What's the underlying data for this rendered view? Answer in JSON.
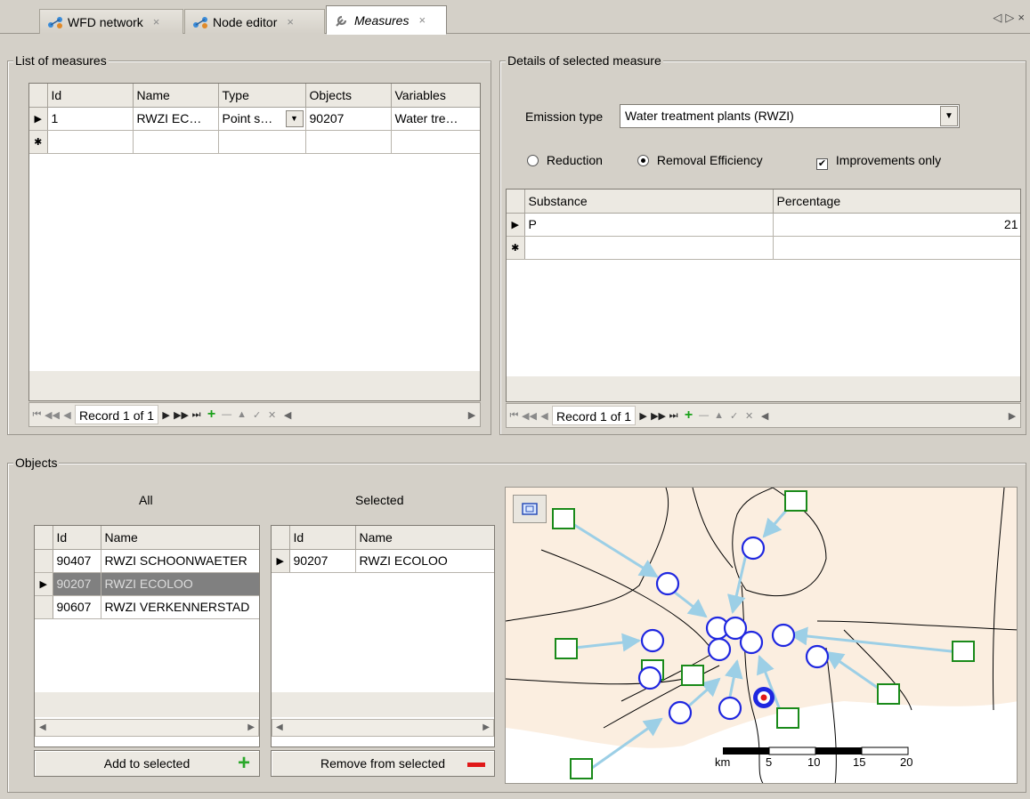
{
  "tabs": [
    {
      "label": "WFD network",
      "icon": "network-icon"
    },
    {
      "label": "Node editor",
      "icon": "network-icon"
    },
    {
      "label": "Measures",
      "icon": "wrench-icon"
    }
  ],
  "list_of_measures": {
    "title": "List of measures",
    "columns": [
      "Id",
      "Name",
      "Type",
      "Objects",
      "Variables"
    ],
    "rows": [
      {
        "id": "1",
        "name": "RWZI EC…",
        "type": "Point s…",
        "objects": "90207",
        "variables": "Water tre…"
      }
    ],
    "navigator": "Record 1 of 1"
  },
  "details": {
    "title": "Details of selected measure",
    "emission_type_label": "Emission type",
    "emission_type_value": "Water treatment plants (RWZI)",
    "radio_reduction": "Reduction",
    "radio_removal": "Removal Efficiency",
    "radio_selected": "Removal Efficiency",
    "checkbox_label": "Improvements only",
    "checkbox_checked": true,
    "columns": [
      "Substance",
      "Percentage"
    ],
    "rows": [
      {
        "substance": "P",
        "percentage": "21"
      }
    ],
    "navigator": "Record 1 of 1"
  },
  "objects": {
    "title": "Objects",
    "all_label": "All",
    "selected_label": "Selected",
    "columns": [
      "Id",
      "Name"
    ],
    "all_rows": [
      {
        "id": "90407",
        "name": "RWZI SCHOONWAETER"
      },
      {
        "id": "90207",
        "name": "RWZI ECOLOO"
      },
      {
        "id": "90607",
        "name": "RWZI VERKENNERSTAD"
      }
    ],
    "all_selected_index": 1,
    "selected_rows": [
      {
        "id": "90207",
        "name": "RWZI ECOLOO"
      }
    ],
    "add_button": "Add to selected",
    "remove_button": "Remove from selected"
  },
  "map": {
    "scale_labels": [
      "km",
      "5",
      "10",
      "15",
      "20"
    ],
    "colors": {
      "land": "#fbeee0",
      "node_circle": "#1f27e0",
      "node_square": "#1a8a1a",
      "flow": "#9ccfe6"
    }
  }
}
